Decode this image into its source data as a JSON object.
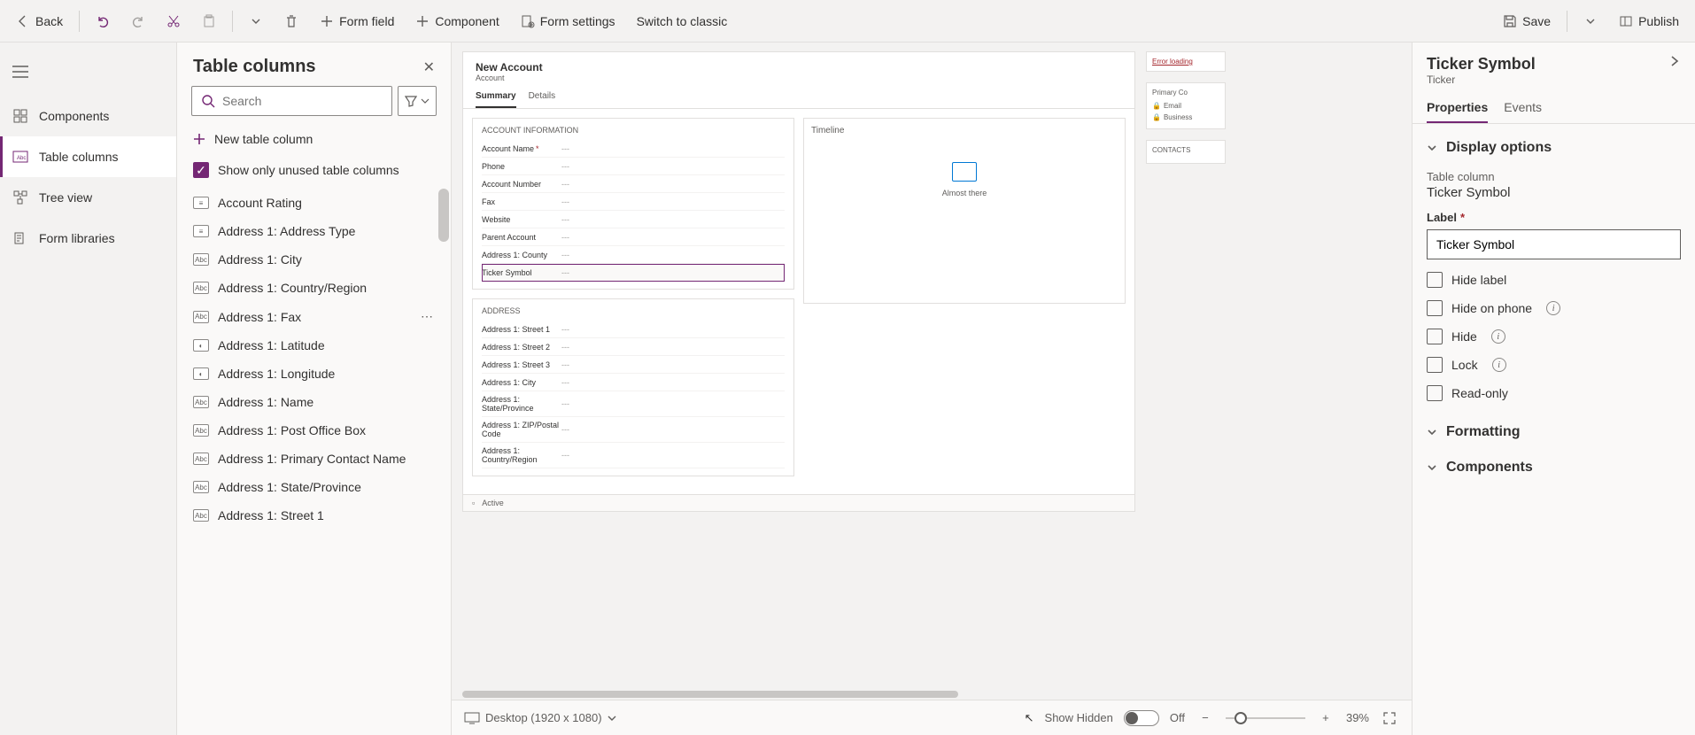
{
  "toolbar": {
    "back": "Back",
    "form_field": "Form field",
    "component": "Component",
    "form_settings": "Form settings",
    "switch_classic": "Switch to classic",
    "save": "Save",
    "publish": "Publish"
  },
  "nav": {
    "components": "Components",
    "table_columns": "Table columns",
    "tree_view": "Tree view",
    "form_libraries": "Form libraries"
  },
  "columns_panel": {
    "title": "Table columns",
    "search_placeholder": "Search",
    "new_column": "New table column",
    "show_unused": "Show only unused table columns",
    "items": [
      {
        "label": "Account Rating",
        "type": "option"
      },
      {
        "label": "Address 1: Address Type",
        "type": "option"
      },
      {
        "label": "Address 1: City",
        "type": "abc"
      },
      {
        "label": "Address 1: Country/Region",
        "type": "abc"
      },
      {
        "label": "Address 1: Fax",
        "type": "abc",
        "show_more": true
      },
      {
        "label": "Address 1: Latitude",
        "type": "float"
      },
      {
        "label": "Address 1: Longitude",
        "type": "float"
      },
      {
        "label": "Address 1: Name",
        "type": "abc"
      },
      {
        "label": "Address 1: Post Office Box",
        "type": "abc"
      },
      {
        "label": "Address 1: Primary Contact Name",
        "type": "abc"
      },
      {
        "label": "Address 1: State/Province",
        "type": "abc"
      },
      {
        "label": "Address 1: Street 1",
        "type": "abc"
      }
    ]
  },
  "form": {
    "title": "New Account",
    "entity": "Account",
    "tabs": [
      "Summary",
      "Details"
    ],
    "section_account": "ACCOUNT INFORMATION",
    "fields_account": [
      {
        "label": "Account Name",
        "req": true,
        "val": "---"
      },
      {
        "label": "Phone",
        "val": "---"
      },
      {
        "label": "Account Number",
        "val": "---"
      },
      {
        "label": "Fax",
        "val": "---"
      },
      {
        "label": "Website",
        "val": "---"
      },
      {
        "label": "Parent Account",
        "val": "---"
      },
      {
        "label": "Address 1: County",
        "val": "---"
      },
      {
        "label": "Ticker Symbol",
        "val": "---",
        "selected": true
      }
    ],
    "section_address": "ADDRESS",
    "fields_address": [
      {
        "label": "Address 1: Street 1",
        "val": "---"
      },
      {
        "label": "Address 1: Street 2",
        "val": "---"
      },
      {
        "label": "Address 1: Street 3",
        "val": "---"
      },
      {
        "label": "Address 1: City",
        "val": "---"
      },
      {
        "label": "Address 1: State/Province",
        "val": "---"
      },
      {
        "label": "Address 1: ZIP/Postal Code",
        "val": "---"
      },
      {
        "label": "Address 1: Country/Region",
        "val": "---"
      }
    ],
    "timeline_title": "Timeline",
    "almost_there": "Almost there",
    "status": "Active",
    "side": {
      "error": "Error loading",
      "primary_contact": "Primary Co",
      "email": "Email",
      "business": "Business",
      "contacts": "CONTACTS"
    }
  },
  "zoom": {
    "device": "Desktop (1920 x 1080)",
    "show_hidden": "Show Hidden",
    "toggle": "Off",
    "percent": "39%"
  },
  "props": {
    "title": "Ticker Symbol",
    "subtitle": "Ticker",
    "tabs": [
      "Properties",
      "Events"
    ],
    "section_display": "Display options",
    "table_column_label": "Table column",
    "table_column_value": "Ticker Symbol",
    "label_label": "Label",
    "label_value": "Ticker Symbol",
    "hide_label": "Hide label",
    "hide_phone": "Hide on phone",
    "hide": "Hide",
    "lock": "Lock",
    "readonly": "Read-only",
    "section_formatting": "Formatting",
    "section_components": "Components"
  }
}
